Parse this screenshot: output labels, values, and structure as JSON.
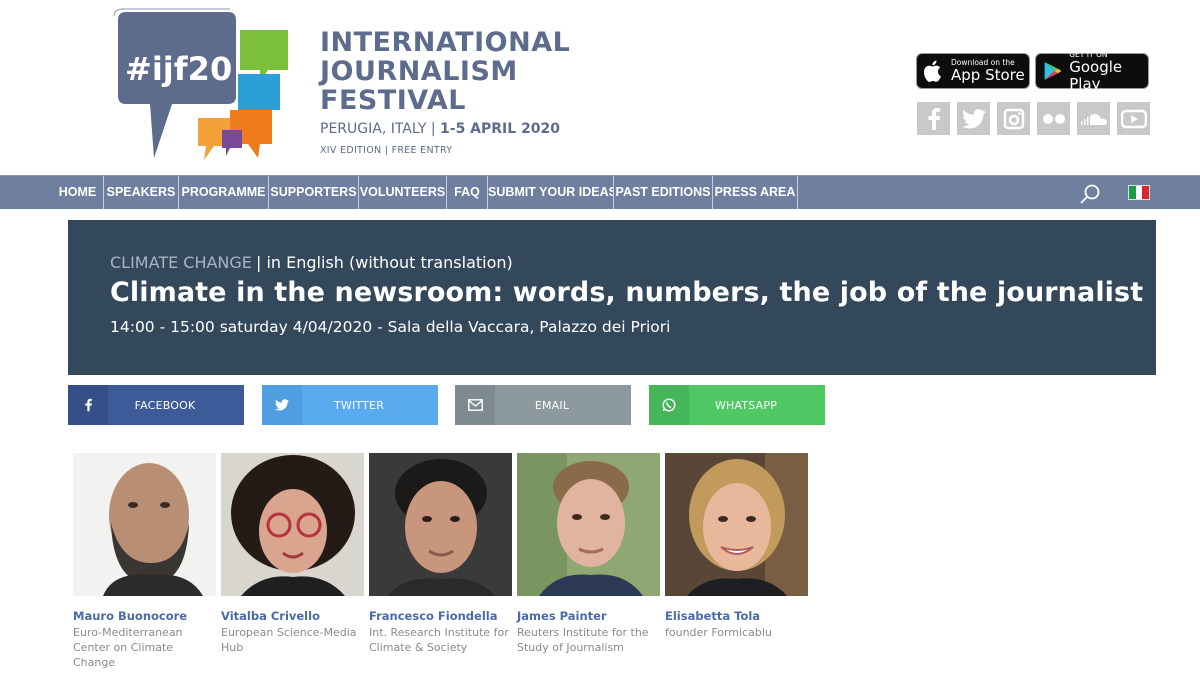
{
  "header": {
    "logo_tag": "#ijf20",
    "logo_lines": [
      "INTERNATIONAL",
      "JOURNALISM",
      "FESTIVAL"
    ],
    "location": "PERUGIA, ITALY",
    "dates": "1-5 APRIL 2020",
    "edition": "XIV EDITION | FREE ENTRY",
    "app_store": {
      "small": "Download on the",
      "big": "App Store"
    },
    "google_play": {
      "small": "GET IT ON",
      "big": "Google Play"
    },
    "social_icons": [
      "facebook-icon",
      "twitter-icon",
      "instagram-icon",
      "flickr-icon",
      "soundcloud-icon",
      "youtube-icon"
    ]
  },
  "nav": {
    "items": [
      "HOME",
      "SPEAKERS",
      "PROGRAMME",
      "SUPPORTERS",
      "VOLUNTEERS",
      "FAQ",
      "SUBMIT YOUR IDEAS",
      "PAST EDITIONS",
      "PRESS AREA"
    ]
  },
  "event": {
    "category": "CLIMATE CHANGE",
    "language": "| in English (without translation)",
    "title": "Climate in the newsroom: words, numbers, the job of the journalist",
    "when": "14:00 - 15:00   saturday 4/04/2020 - Sala della Vaccara, Palazzo dei Priori"
  },
  "share": {
    "facebook": "FACEBOOK",
    "twitter": "TWITTER",
    "email": "EMAIL",
    "whatsapp": "WHATSAPP"
  },
  "speakers": [
    {
      "name": "Mauro Buonocore",
      "affiliation": "Euro-Mediterranean Center on Climate Change"
    },
    {
      "name": "Vitalba Crivello",
      "affiliation": "European Science-Media Hub"
    },
    {
      "name": "Francesco Fiondella",
      "affiliation": "Int. Research Institute for Climate & Society"
    },
    {
      "name": "James Painter",
      "affiliation": "Reuters Institute for the Study of Journalism"
    },
    {
      "name": "Elisabetta Tola",
      "affiliation": "founder Formicablu"
    }
  ],
  "colors": {
    "nav_bg": "#6f7fa0",
    "banner_bg": "#34485c",
    "logo_blue": "#5d6b8c",
    "speaker_name": "#4a6aa8"
  }
}
